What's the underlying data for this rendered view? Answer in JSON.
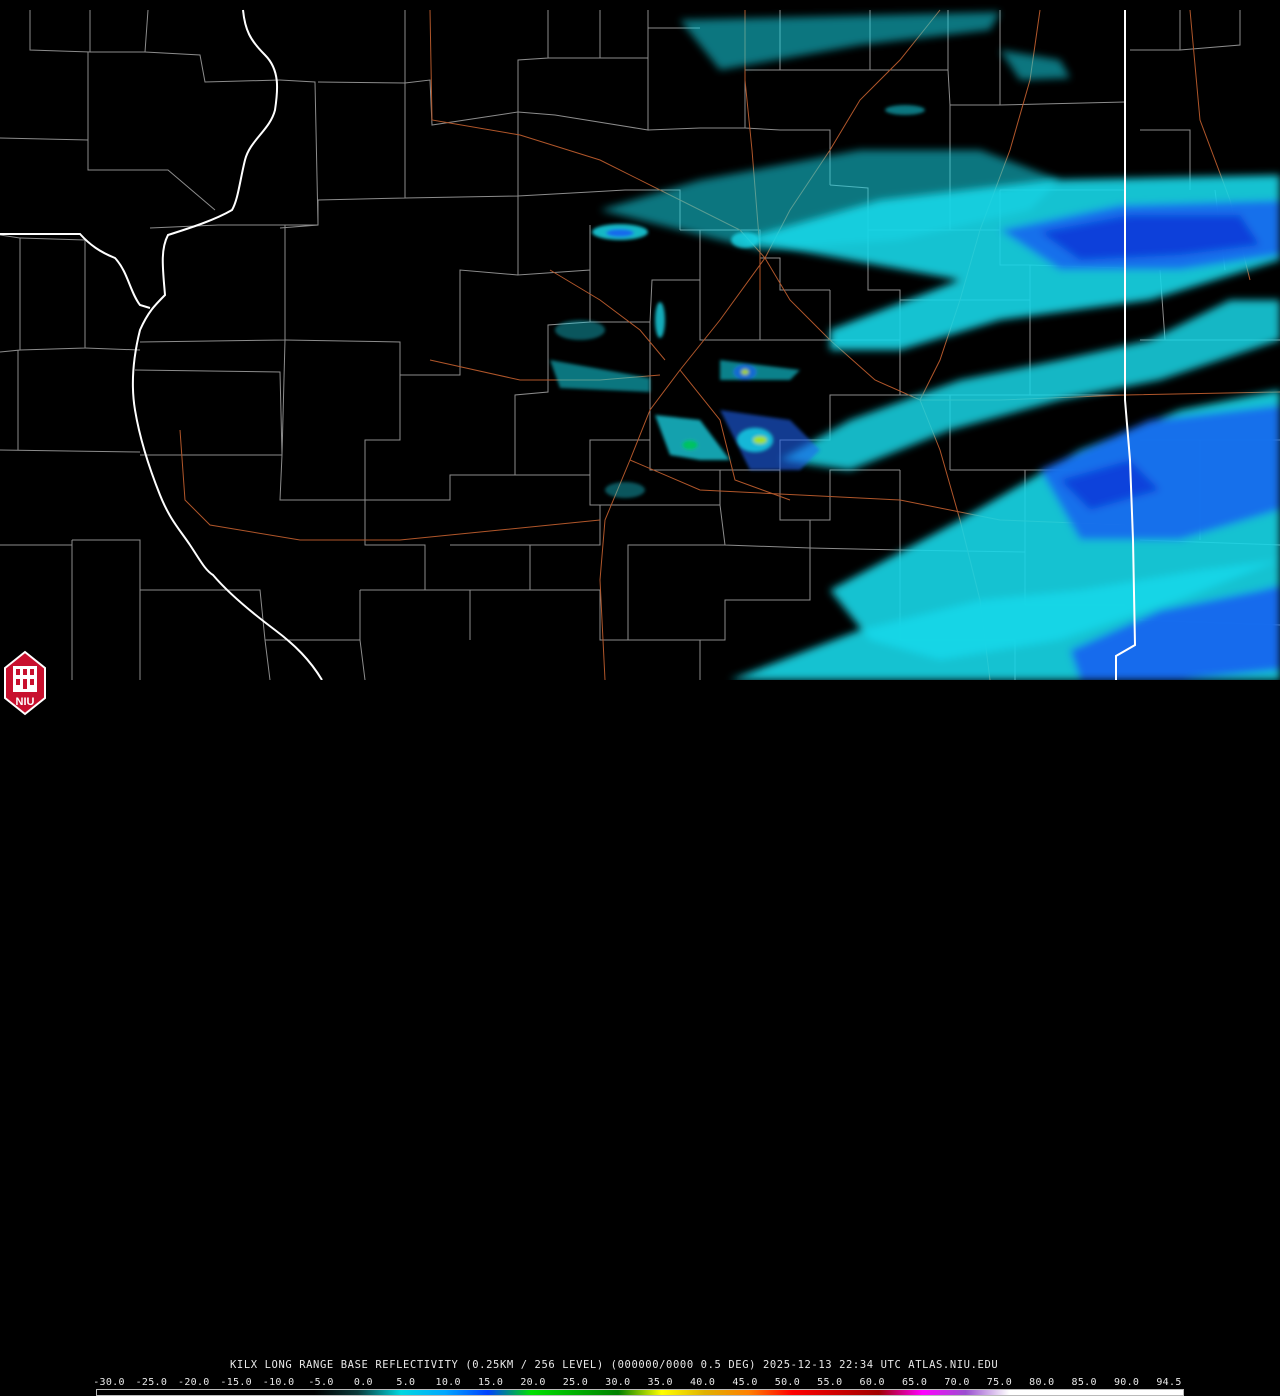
{
  "product": {
    "caption": "KILX LONG RANGE BASE REFLECTIVITY (0.25KM / 256 LEVEL) (000000/0000 0.5 DEG) 2025-12-13 22:34 UTC  ATLAS.NIU.EDU"
  },
  "colorbar": {
    "ticks": [
      "-30.0",
      "-25.0",
      "-20.0",
      "-15.0",
      "-10.0",
      "-5.0",
      "0.0",
      "5.0",
      "10.0",
      "15.0",
      "20.0",
      "25.0",
      "30.0",
      "35.0",
      "40.0",
      "45.0",
      "50.0",
      "55.0",
      "60.0",
      "65.0",
      "70.0",
      "75.0",
      "80.0",
      "85.0",
      "90.0",
      "94.5"
    ],
    "colors": [
      "#000000",
      "#000000",
      "#000000",
      "#000000",
      "#000000",
      "#000000",
      "#0a3a3a",
      "#00d8e0",
      "#00a8ff",
      "#0040ff",
      "#00e000",
      "#00b000",
      "#008000",
      "#ffff00",
      "#e0b000",
      "#ff8000",
      "#ff0000",
      "#d00000",
      "#a00000",
      "#ff00ff",
      "#9a4fd0",
      "#ffffff",
      "#ffffff",
      "#ffffff",
      "#ffffff",
      "#ffffff"
    ]
  },
  "logo": {
    "text": "NIU"
  },
  "colors": {
    "state_border": "#ffffff",
    "county_border": "#9a9a9a",
    "highway": "#b0562a",
    "light_echo": "#18d7e8",
    "moderate_echo": "#1a62f0",
    "strong_echo": "#0b3ad8"
  }
}
